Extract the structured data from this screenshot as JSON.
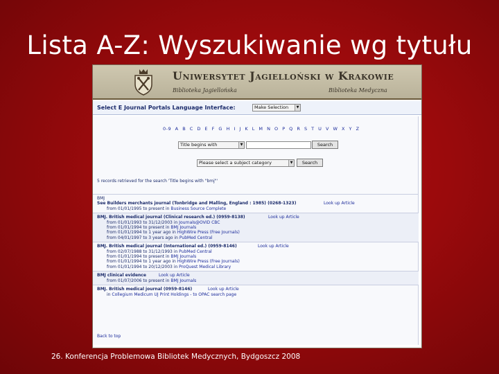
{
  "slide": {
    "title": "Lista A-Z: Wyszukiwanie wg tytułu",
    "footer": "26. Konferencja Problemowa Bibliotek Medycznych, Bydgoszcz 2008"
  },
  "banner": {
    "university": "Uniwersytet Jagielloński w Krakowie",
    "library_left": "Biblioteka Jagiellońska",
    "library_right": "Biblioteka Medyczna",
    "crest_icon": "university-crest-icon"
  },
  "language": {
    "label": "Select E Journal Portals Language Interface:",
    "selected": "Make Selection"
  },
  "search": {
    "alphabet": "0-9 A B C D E F G H I J K L M N O P Q R S T U V W X Y Z",
    "mode_selected": "Title begins with",
    "query": "",
    "search_label": "Search",
    "subject_selected": "Please select a subject category",
    "subject_search_label": "Search"
  },
  "results": {
    "summary": "5 records retrieved for the search 'Title begins with \"bmj\"'",
    "back_to_top": "Back to top",
    "look_up": "Look up Article",
    "records": [
      {
        "pre": "BMJ",
        "title": "See  Builders merchants journal (Tonbridge and Malling, England : 1985) (0268-1323)",
        "lines": [
          {
            "dates": "from 01/01/1995 to present in",
            "source": "Business Source Complete"
          }
        ]
      },
      {
        "title": "BMJ. British medical journal (Clinical research ed.) (0959-8138)",
        "lines": [
          {
            "dates": "from 01/01/1993 to 31/12/2003 in",
            "source": "Journals@OVID CBC"
          },
          {
            "dates": "from 01/01/1994 to present in",
            "source": "BMJ Journals"
          },
          {
            "dates": "from 01/01/1994 to 1 year ago in",
            "source": "HighWire Press (Free Journals)"
          },
          {
            "dates": "from 04/01/1997 to 3 years ago in",
            "source": "PubMed Central"
          }
        ]
      },
      {
        "title": "BMJ. British medical journal (International ed.) (0959-8146)",
        "lines": [
          {
            "dates": "from 02/07/1988 to 31/12/1993 in",
            "source": "PubMed Central"
          },
          {
            "dates": "from 01/01/1994 to present in",
            "source": "BMJ Journals"
          },
          {
            "dates": "from 01/01/1994 to 1 year ago in",
            "source": "HighWire Press (Free Journals)"
          },
          {
            "dates": "from 01/01/1994 to 20/12/2003 in",
            "source": "ProQuest Medical Library"
          }
        ]
      },
      {
        "title": "BMJ clinical evidence",
        "lines": [
          {
            "dates": "from 01/07/2006 to present in",
            "source": "BMJ Journals"
          }
        ]
      },
      {
        "title": "BMJ. British medical journal (0959-8146)",
        "lines": [
          {
            "dates": "in",
            "source": "Collegium Medicum UJ Print Holdings - to OPAC search page"
          }
        ]
      }
    ]
  }
}
